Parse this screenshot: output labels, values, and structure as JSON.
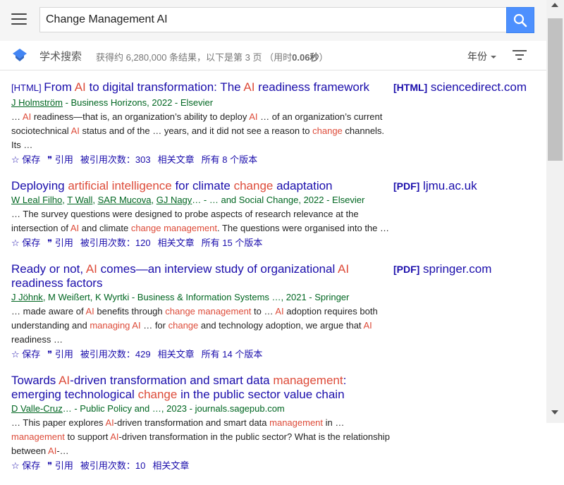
{
  "header": {
    "query": "Change Management AI",
    "brand": "学术搜索",
    "stats_prefix": "获得约 6,280,000 条结果，以下是第 3 页",
    "stats_time_open": "（用时",
    "stats_time": "0.06秒",
    "stats_time_close": "）",
    "year_label": "年份",
    "accent_color": "#4d90fe"
  },
  "actions": {
    "save": "保存",
    "cite": "引用",
    "related": "相关文章"
  },
  "results": [
    {
      "title_parts": [
        {
          "t": "[HTML] ",
          "cls": "tag"
        },
        {
          "t": "From "
        },
        {
          "t": "AI",
          "cls": "hl"
        },
        {
          "t": " to digital transformation: The "
        },
        {
          "t": "AI",
          "cls": "hl"
        },
        {
          "t": " readiness framework"
        }
      ],
      "side_tag": "[HTML]",
      "side_domain": "sciencedirect.com",
      "authors": [
        {
          "name": "J Holmström",
          "link": true
        }
      ],
      "source": " - Business Horizons, 2022 - Elsevier",
      "snippet_parts": [
        {
          "t": "… "
        },
        {
          "t": "AI",
          "cls": "hl"
        },
        {
          "t": " readiness—that is, an organization’s ability to deploy "
        },
        {
          "t": "AI",
          "cls": "hl"
        },
        {
          "t": " … of an organization’s current sociotechnical "
        },
        {
          "t": "AI",
          "cls": "hl"
        },
        {
          "t": " status and of the … years, and it did not see a reason to "
        },
        {
          "t": "change",
          "cls": "hl"
        },
        {
          "t": " channels. Its …"
        }
      ],
      "cited": "被引用次数：303",
      "versions": "所有 8 个版本"
    },
    {
      "title_parts": [
        {
          "t": "Deploying "
        },
        {
          "t": "artificial intelligence",
          "cls": "hl"
        },
        {
          "t": " for climate "
        },
        {
          "t": "change",
          "cls": "hl"
        },
        {
          "t": " adaptation"
        }
      ],
      "side_tag": "[PDF]",
      "side_domain": "ljmu.ac.uk",
      "authors": [
        {
          "name": "W Leal Filho",
          "link": true
        },
        {
          "name": ", ",
          "link": false
        },
        {
          "name": "T Wall",
          "link": true
        },
        {
          "name": ", ",
          "link": false
        },
        {
          "name": "SAR Mucova",
          "link": true
        },
        {
          "name": ", ",
          "link": false
        },
        {
          "name": "GJ Nagy",
          "link": true
        }
      ],
      "source_parts": [
        {
          "t": "… - … and Social "
        },
        {
          "t": "Change",
          "cls": "hl"
        },
        {
          "t": ", 2022 - Elsevier"
        }
      ],
      "snippet_parts": [
        {
          "t": "… The survey questions were designed to probe aspects of research relevance at the intersection of "
        },
        {
          "t": "AI",
          "cls": "hl"
        },
        {
          "t": " and climate "
        },
        {
          "t": "change management",
          "cls": "hl"
        },
        {
          "t": ". The questions were organised into the …"
        }
      ],
      "cited": "被引用次数：120",
      "versions": "所有 15 个版本"
    },
    {
      "title_parts": [
        {
          "t": "Ready or not, "
        },
        {
          "t": "AI",
          "cls": "hl"
        },
        {
          "t": " comes—an interview study of organizational "
        },
        {
          "t": "AI",
          "cls": "hl"
        },
        {
          "t": " readiness factors"
        }
      ],
      "side_tag": "[PDF]",
      "side_domain": "springer.com",
      "authors": [
        {
          "name": "J Jöhnk",
          "link": true
        },
        {
          "name": ", M Weißert, K Wyrtki",
          "link": false
        }
      ],
      "source": " - Business & Information Systems …, 2021 - Springer",
      "snippet_parts": [
        {
          "t": "… made aware of "
        },
        {
          "t": "AI",
          "cls": "hl"
        },
        {
          "t": " benefits through "
        },
        {
          "t": "change management",
          "cls": "hl"
        },
        {
          "t": " to … "
        },
        {
          "t": "AI",
          "cls": "hl"
        },
        {
          "t": " adoption requires both understanding and "
        },
        {
          "t": "managing AI",
          "cls": "hl"
        },
        {
          "t": " … for "
        },
        {
          "t": "change",
          "cls": "hl"
        },
        {
          "t": " and technology adoption, we argue that "
        },
        {
          "t": "AI",
          "cls": "hl"
        },
        {
          "t": " readiness …"
        }
      ],
      "cited": "被引用次数：429",
      "versions": "所有 14 个版本"
    },
    {
      "title_parts": [
        {
          "t": "Towards "
        },
        {
          "t": "AI",
          "cls": "hl"
        },
        {
          "t": "-driven transformation and smart data "
        },
        {
          "t": "management",
          "cls": "hl"
        },
        {
          "t": ": emerging technological "
        },
        {
          "t": "change",
          "cls": "hl"
        },
        {
          "t": " in the public sector value chain"
        }
      ],
      "side_tag": "",
      "side_domain": "",
      "authors": [
        {
          "name": "D Valle-Cruz",
          "link": true
        }
      ],
      "source": "… - Public Policy and …, 2023 - journals.sagepub.com",
      "snippet_parts": [
        {
          "t": "… This paper explores "
        },
        {
          "t": "AI",
          "cls": "hl"
        },
        {
          "t": "-driven transformation and smart data "
        },
        {
          "t": "management",
          "cls": "hl"
        },
        {
          "t": " in … "
        },
        {
          "t": "management",
          "cls": "hl"
        },
        {
          "t": " to support "
        },
        {
          "t": "AI",
          "cls": "hl"
        },
        {
          "t": "-driven transformation in the public sector? What is the relationship between "
        },
        {
          "t": "AI",
          "cls": "hl"
        },
        {
          "t": "-…"
        }
      ],
      "cited": "被引用次数：10",
      "versions": ""
    }
  ]
}
